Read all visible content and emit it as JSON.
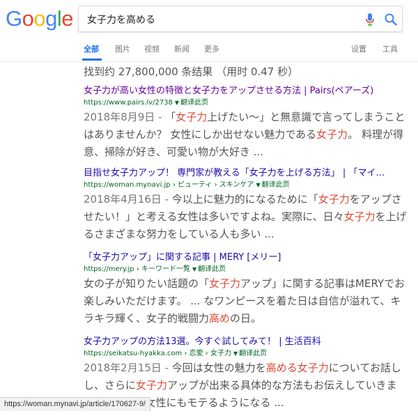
{
  "search": {
    "query": "女子力を高める"
  },
  "tabs": {
    "all": "全部",
    "images": "图片",
    "videos": "视频",
    "news": "新闻",
    "more": "更多",
    "settings": "设置",
    "tools": "工具"
  },
  "stats": "找到约 27,800,000 条结果 （用时 0.47 秒）",
  "translate_label": "翻译此页",
  "results": [
    {
      "title": "女子力が高い女性の特徴と女子力をアップさせる方法 | Pairs(ペアーズ)",
      "url": "https://www.pairs.lv/2738",
      "date": "2018年8月9日 - ",
      "s1": "「",
      "s2": "女子力",
      "s3": "上げたい〜」と無意識で言ってしまうことはありませんか？ 女性にしか出せない魅力である",
      "s4": "女子力",
      "s5": "。 料理が得意、掃除が好き、可愛い物が大好き ..."
    },
    {
      "title": "目指せ女子力アップ！ 専門家が教える「女子力を上げる方法」 | 「マイ…",
      "url": "https://woman.mynavi.jp › ビューティ › スキンケア",
      "date": "2018年4月16日 - ",
      "s1": "今以上に魅力的になるために「",
      "s2": "女子力",
      "s3": "をアップさせたい！」と考える女性は多いですよね。実際に、日々",
      "s4": "女子力",
      "s5": "を上げるさまざまな努力をしている人も多い ..."
    },
    {
      "title": "「女子力アップ」に関する記事 | MERY [メリー]",
      "url": "https://mery.jp › キーワード一覧",
      "date": "",
      "s1": "女の子が知りたい話題の「",
      "s2": "女子力",
      "s3": "アップ」に関する記事はMERYでお楽しみいただけます。 ... なワンピースを着た日は自信が溢れて、キラキラ輝く、女子的戦闘力",
      "s4": "高め",
      "s5": "の日。"
    },
    {
      "title": "女子力アップの方法13選。今すぐ試してみて！ | 生活百科",
      "url": "https://seikatsu-hyakka.com › 恋愛 › 女子力",
      "date": "2018年2月15日 - ",
      "s1": "今回は女性の魅力を",
      "s2": "高める女子力",
      "s3": "についてお話しし、さらに",
      "s4": "女子力",
      "s5": "アップが出来る具体的な方法もお伝えしていきます。男性にも女性にもモテるようになる ..."
    }
  ],
  "status_url": "https://woman.mynavi.jp/article/170627-9/"
}
